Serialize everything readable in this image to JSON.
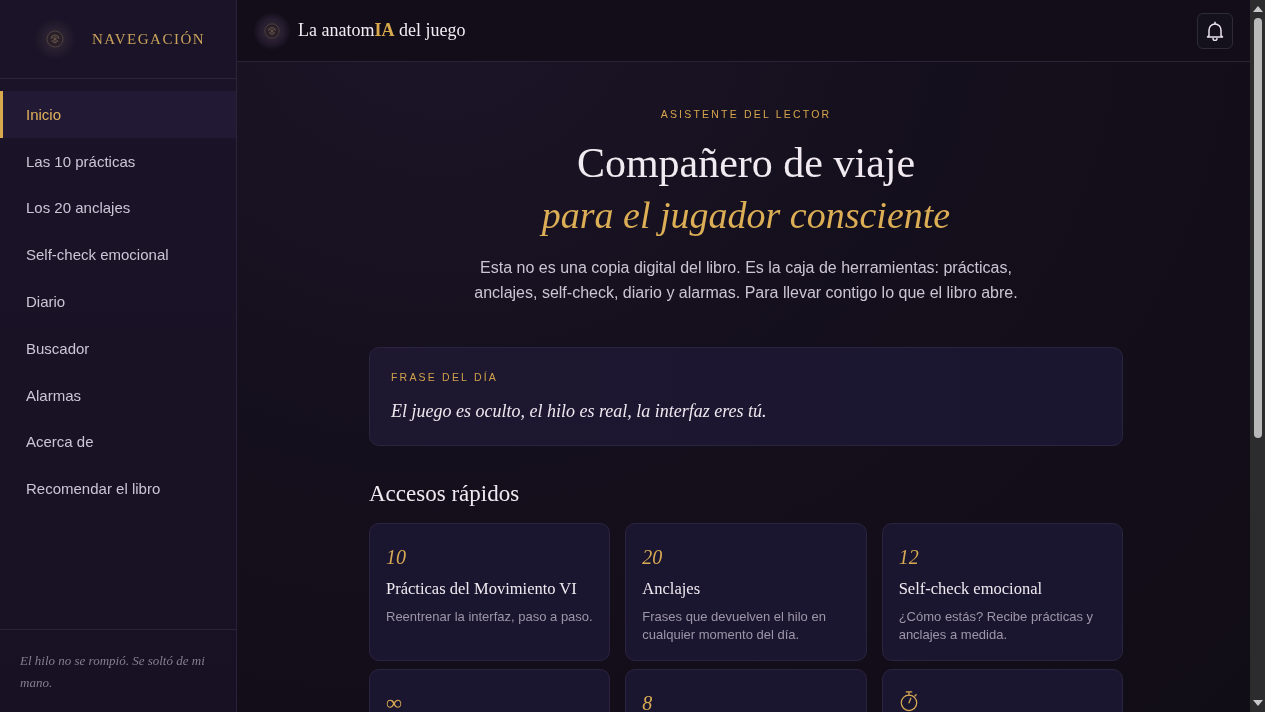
{
  "sidebar": {
    "title": "NAVEGACIÓN",
    "items": [
      {
        "label": "Inicio",
        "selected": true
      },
      {
        "label": "Las 10 prácticas",
        "selected": false
      },
      {
        "label": "Los 20 anclajes",
        "selected": false
      },
      {
        "label": "Self-check emocional",
        "selected": false
      },
      {
        "label": "Diario",
        "selected": false
      },
      {
        "label": "Buscador",
        "selected": false
      },
      {
        "label": "Alarmas",
        "selected": false
      },
      {
        "label": "Acerca de",
        "selected": false
      },
      {
        "label": "Recomendar el libro",
        "selected": false
      }
    ],
    "footer_quote": "El hilo no se rompió. Se soltó de mi mano."
  },
  "header": {
    "title": "La anatom**IA** del juego"
  },
  "hero": {
    "eyebrow": "ASISTENTE DEL LECTOR",
    "title": "Compañero de viaje",
    "subtitle": "para el jugador consciente",
    "description": "Esta no es una copia digital del libro. Es la caja de herramientas: prácticas, anclajes, self-check, diario y alarmas. Para llevar contigo lo que el libro abre."
  },
  "quote_of_day": {
    "label": "FRASE DEL DÍA",
    "text": "El juego es oculto, el hilo es real, la interfaz eres tú."
  },
  "quick_access": {
    "title": "Accesos rápidos",
    "cards": [
      {
        "kind": "number",
        "number": "10",
        "title": "Prácticas del Movimiento VI",
        "description": "Reentrenar la interfaz, paso a paso."
      },
      {
        "kind": "number",
        "number": "20",
        "title": "Anclajes",
        "description": "Frases que devuelven el hilo en cualquier momento del día."
      },
      {
        "kind": "number",
        "number": "12",
        "title": "Self-check emocional",
        "description": "¿Cómo estás? Recibe prácticas y anclajes a medida."
      },
      {
        "kind": "symbol",
        "number": "∞"
      },
      {
        "kind": "number",
        "number": "8"
      },
      {
        "kind": "icon"
      }
    ]
  }
}
